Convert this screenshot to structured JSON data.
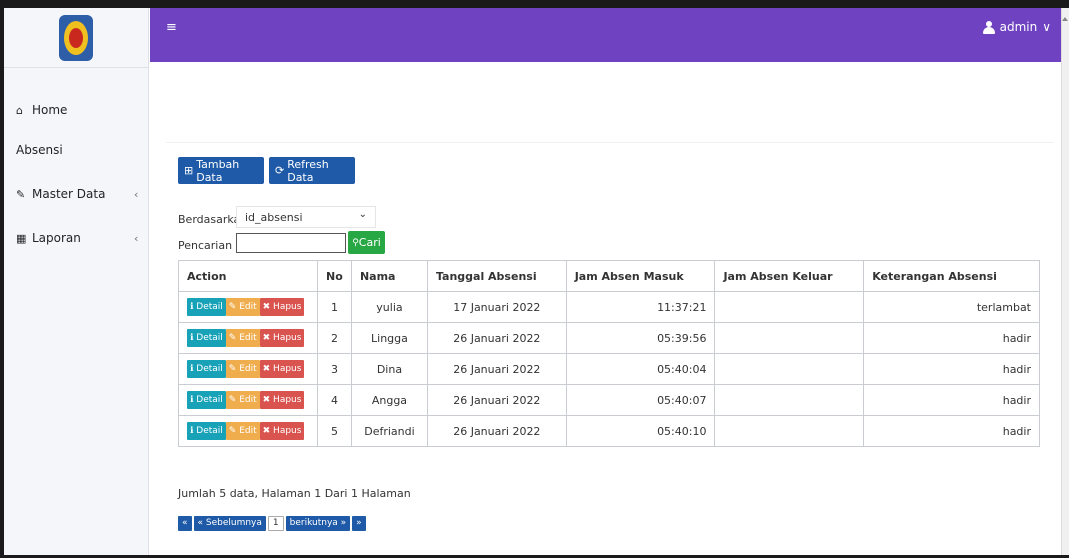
{
  "header": {
    "menu_icon": "bars-icon",
    "user_label": "admin",
    "user_caret": "∨"
  },
  "sidebar": {
    "items": [
      {
        "label": "Home",
        "icon": "home-icon",
        "glyph": "⌂"
      },
      {
        "label": "Absensi"
      },
      {
        "label": "Master Data",
        "icon": "edit-icon",
        "glyph": "✎",
        "chev": "‹"
      },
      {
        "label": "Laporan",
        "icon": "calendar-icon",
        "glyph": "▦",
        "chev": "‹"
      }
    ]
  },
  "toolbar": {
    "tambah_label": "Tambah Data",
    "refresh_label": "Refresh Data",
    "tambah_glyph": "⊞",
    "refresh_glyph": "⟳"
  },
  "filter": {
    "berdasarkan_label": "Berdasarkan:",
    "select_value": "id_absensi",
    "pencarian_label": "Pencarian",
    "search_value": "",
    "cari_label": "Cari",
    "cari_glyph": "🔍"
  },
  "table": {
    "columns": [
      "Action",
      "No",
      "Nama",
      "Tanggal Absensi",
      "Jam Absen Masuk",
      "Jam Absen Keluar",
      "Keterangan Absensi"
    ],
    "action_labels": {
      "detail": "Detail",
      "edit": "Edit",
      "hapus": "Hapus"
    },
    "rows": [
      {
        "no": "1",
        "nama": "yulia",
        "tanggal": "17 Januari 2022",
        "masuk": "11:37:21",
        "keluar": "",
        "ket": "terlambat"
      },
      {
        "no": "2",
        "nama": "Lingga",
        "tanggal": "26 Januari 2022",
        "masuk": "05:39:56",
        "keluar": "",
        "ket": "hadir"
      },
      {
        "no": "3",
        "nama": "Dina",
        "tanggal": "26 Januari 2022",
        "masuk": "05:40:04",
        "keluar": "",
        "ket": "hadir"
      },
      {
        "no": "4",
        "nama": "Angga",
        "tanggal": "26 Januari 2022",
        "masuk": "05:40:07",
        "keluar": "",
        "ket": "hadir"
      },
      {
        "no": "5",
        "nama": "Defriandi",
        "tanggal": "26 Januari 2022",
        "masuk": "05:40:10",
        "keluar": "",
        "ket": "hadir"
      }
    ]
  },
  "summary": "Jumlah 5 data, Halaman 1 Dari 1 Halaman",
  "pagination": {
    "first": "«",
    "prev": "« Sebelumnya",
    "current": "1",
    "next": "berikutnya »",
    "last": "»"
  },
  "colors": {
    "topbar": "#6f42c1",
    "primary": "#1e5aa8",
    "success": "#28a745",
    "info": "#17a2b8",
    "warning": "#f0ad4e",
    "danger": "#d9534f"
  }
}
